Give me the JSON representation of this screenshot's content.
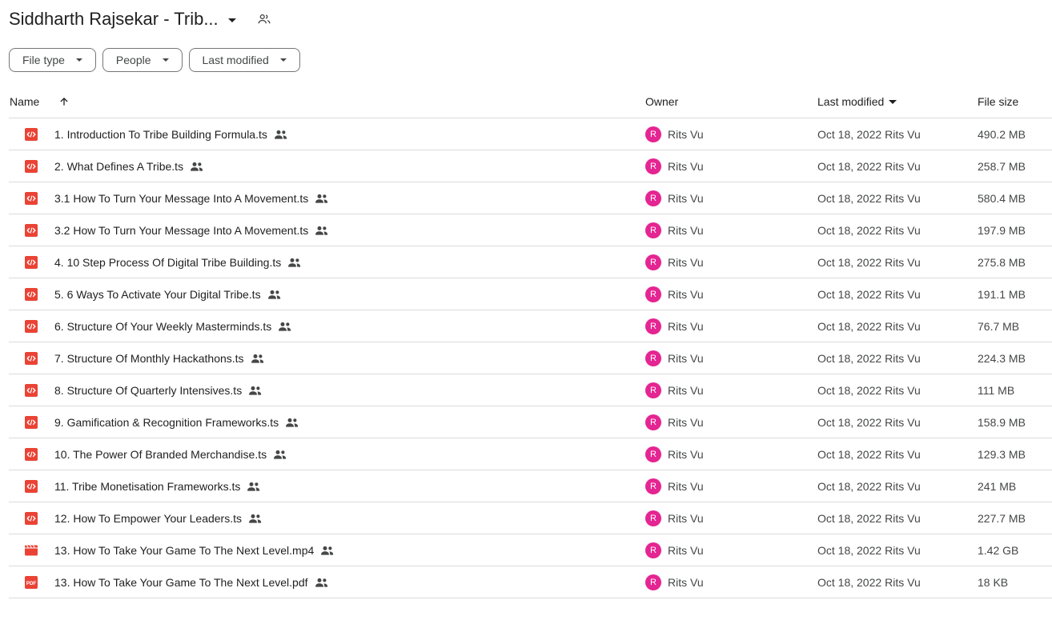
{
  "header": {
    "title": "Siddharth Rajsekar - Trib...",
    "caret_icon": "arrow-drop-down-icon",
    "shared_icon": "people-icon"
  },
  "filters": [
    {
      "label": "File type"
    },
    {
      "label": "People"
    },
    {
      "label": "Last modified"
    }
  ],
  "columns": {
    "name": "Name",
    "owner": "Owner",
    "modified": "Last modified",
    "size": "File size"
  },
  "colors": {
    "code_icon": "#ea4335",
    "video_icon": "#ea4335",
    "pdf_icon": "#ea4335",
    "avatar": "#e52592"
  },
  "files": [
    {
      "name": "1. Introduction To Tribe Building Formula.ts",
      "type": "code",
      "owner_initial": "R",
      "owner": "Rits Vu",
      "modified_date": "Oct 18, 2022",
      "modified_by": "Rits Vu",
      "size": "490.2 MB"
    },
    {
      "name": "2. What Defines A Tribe.ts",
      "type": "code",
      "owner_initial": "R",
      "owner": "Rits Vu",
      "modified_date": "Oct 18, 2022",
      "modified_by": "Rits Vu",
      "size": "258.7 MB"
    },
    {
      "name": "3.1 How To Turn Your Message Into A Movement.ts",
      "type": "code",
      "owner_initial": "R",
      "owner": "Rits Vu",
      "modified_date": "Oct 18, 2022",
      "modified_by": "Rits Vu",
      "size": "580.4 MB"
    },
    {
      "name": "3.2 How To Turn Your Message Into A Movement.ts",
      "type": "code",
      "owner_initial": "R",
      "owner": "Rits Vu",
      "modified_date": "Oct 18, 2022",
      "modified_by": "Rits Vu",
      "size": "197.9 MB"
    },
    {
      "name": "4. 10 Step Process Of Digital Tribe Building.ts",
      "type": "code",
      "owner_initial": "R",
      "owner": "Rits Vu",
      "modified_date": "Oct 18, 2022",
      "modified_by": "Rits Vu",
      "size": "275.8 MB"
    },
    {
      "name": "5. 6 Ways To Activate Your Digital Tribe.ts",
      "type": "code",
      "owner_initial": "R",
      "owner": "Rits Vu",
      "modified_date": "Oct 18, 2022",
      "modified_by": "Rits Vu",
      "size": "191.1 MB"
    },
    {
      "name": "6. Structure Of Your Weekly Masterminds.ts",
      "type": "code",
      "owner_initial": "R",
      "owner": "Rits Vu",
      "modified_date": "Oct 18, 2022",
      "modified_by": "Rits Vu",
      "size": "76.7 MB"
    },
    {
      "name": "7. Structure Of Monthly Hackathons.ts",
      "type": "code",
      "owner_initial": "R",
      "owner": "Rits Vu",
      "modified_date": "Oct 18, 2022",
      "modified_by": "Rits Vu",
      "size": "224.3 MB"
    },
    {
      "name": "8. Structure Of Quarterly Intensives.ts",
      "type": "code",
      "owner_initial": "R",
      "owner": "Rits Vu",
      "modified_date": "Oct 18, 2022",
      "modified_by": "Rits Vu",
      "size": "111 MB"
    },
    {
      "name": "9. Gamification & Recognition Frameworks.ts",
      "type": "code",
      "owner_initial": "R",
      "owner": "Rits Vu",
      "modified_date": "Oct 18, 2022",
      "modified_by": "Rits Vu",
      "size": "158.9 MB"
    },
    {
      "name": "10. The Power Of Branded Merchandise.ts",
      "type": "code",
      "owner_initial": "R",
      "owner": "Rits Vu",
      "modified_date": "Oct 18, 2022",
      "modified_by": "Rits Vu",
      "size": "129.3 MB"
    },
    {
      "name": "11. Tribe Monetisation Frameworks.ts",
      "type": "code",
      "owner_initial": "R",
      "owner": "Rits Vu",
      "modified_date": "Oct 18, 2022",
      "modified_by": "Rits Vu",
      "size": "241 MB"
    },
    {
      "name": "12. How To Empower Your Leaders.ts",
      "type": "code",
      "owner_initial": "R",
      "owner": "Rits Vu",
      "modified_date": "Oct 18, 2022",
      "modified_by": "Rits Vu",
      "size": "227.7 MB"
    },
    {
      "name": "13. How To Take Your Game To The Next Level.mp4",
      "type": "video",
      "owner_initial": "R",
      "owner": "Rits Vu",
      "modified_date": "Oct 18, 2022",
      "modified_by": "Rits Vu",
      "size": "1.42 GB"
    },
    {
      "name": "13. How To Take Your Game To The Next Level.pdf",
      "type": "pdf",
      "owner_initial": "R",
      "owner": "Rits Vu",
      "modified_date": "Oct 18, 2022",
      "modified_by": "Rits Vu",
      "size": "18 KB"
    }
  ]
}
